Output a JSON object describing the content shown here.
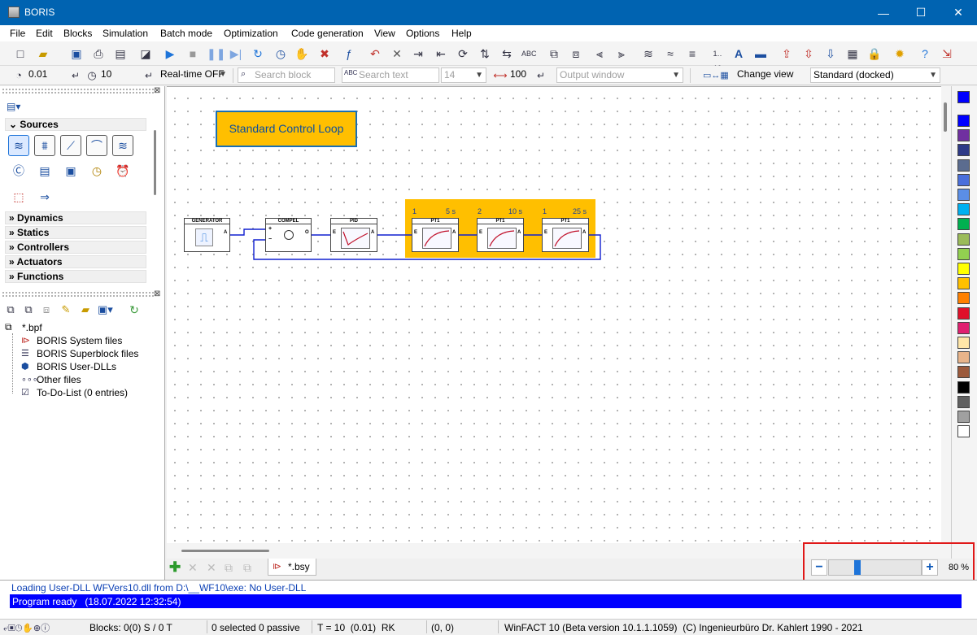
{
  "window": {
    "title": "BORIS",
    "minimize": "—",
    "maximize": "☐",
    "close": "✕"
  },
  "menu": [
    "File",
    "Edit",
    "Blocks",
    "Simulation",
    "Batch mode",
    "Optimization",
    "Code generation",
    "View",
    "Options",
    "Help"
  ],
  "toolbar2": {
    "step_size": "0.01",
    "sim_time": "10",
    "realtime": "Real-time OFF",
    "search_block_placeholder": "Search block",
    "search_text_placeholder": "Search text",
    "font_size": "14",
    "width_value": "100",
    "output_window_placeholder": "Output window",
    "change_view": "Change view",
    "view_mode": "Standard (docked)"
  },
  "library": {
    "categories": [
      "Sources",
      "Dynamics",
      "Statics",
      "Controllers",
      "Actuators",
      "Functions"
    ]
  },
  "project_tree": {
    "root": "*.bpf",
    "items": [
      "BORIS System files",
      "BORIS Superblock files",
      "BORIS User-DLLs",
      "Other files",
      "To-Do-List (0 entries)"
    ]
  },
  "diagram": {
    "title": "Standard Control Loop",
    "blocks": {
      "generator": "GENERATOR",
      "compel": "COMPEL",
      "pid": "PID",
      "pt1": "PT1"
    },
    "pt1_params": [
      {
        "k": "1",
        "t": "5 s"
      },
      {
        "k": "2",
        "t": "10 s"
      },
      {
        "k": "1",
        "t": "25 s"
      }
    ],
    "port_in": "E",
    "port_out": "A",
    "plus": "+",
    "minus": "−",
    "out": "O"
  },
  "tabs": {
    "file": "*.bsy"
  },
  "zoom": {
    "value": "80 %",
    "fraction": 0.3,
    "minus": "−",
    "plus": "+"
  },
  "messages": {
    "line1": "Loading User-DLL WFVers10.dll from D:\\__WF10\\exe: No User-DLL",
    "line2": "Program ready   (18.07.2022 12:32:54)"
  },
  "status": {
    "blocks": "Blocks: 0(0) S / 0 T",
    "selected": "0 selected  0 passive",
    "time": "T = 10  (0.01)  RK",
    "coords": "(0, 0)",
    "version": "WinFACT 10 (Beta version 10.1.1.1059)  (C) Ingenieurbüro Dr. Kahlert 1990 - 2021"
  },
  "colors": {
    "accent": "#0063b1",
    "group": "#ffbf00",
    "highlight": "#e01818",
    "message_bar": "#0000ff"
  },
  "palette": [
    "#0000ff",
    "#0000ff",
    "#7030a0",
    "#2e3a87",
    "#5b6c8f",
    "#4a6fdc",
    "#5b8ee6",
    "#00b0f0",
    "#00b050",
    "#9bbb59",
    "#92d050",
    "#ffff00",
    "#ffc000",
    "#ff8000",
    "#e0102a",
    "#e02070",
    "#ffe6a8",
    "#e8b48a",
    "#9c5a3c",
    "#000000",
    "#606060",
    "#a0a0a0",
    "#ffffff"
  ]
}
